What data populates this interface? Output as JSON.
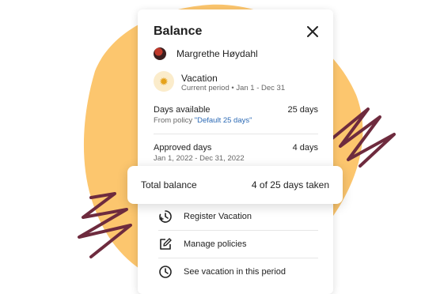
{
  "card": {
    "title": "Balance",
    "user_name": "Margrethe Høydahl",
    "policy": {
      "name": "Vacation",
      "period": "Current period • Jan 1 - Dec 31"
    },
    "days_available": {
      "label": "Days available",
      "value": "25 days",
      "source_prefix": "From policy",
      "source_link": "\"Default 25 days\""
    },
    "approved_days": {
      "label": "Approved days",
      "value": "4 days",
      "range": "Jan 1, 2022 - Dec 31, 2022"
    }
  },
  "total": {
    "label": "Total balance",
    "value": "4 of 25 days taken"
  },
  "actions": [
    {
      "label": "Register Vacation",
      "icon": "clock-add-icon"
    },
    {
      "label": "Manage policies",
      "icon": "edit-icon"
    },
    {
      "label": "See vacation in this period",
      "icon": "clock-icon"
    }
  ],
  "colors": {
    "blob": "#FCC66E",
    "scribble": "#6E2B3E",
    "link": "#2C6AB5"
  }
}
